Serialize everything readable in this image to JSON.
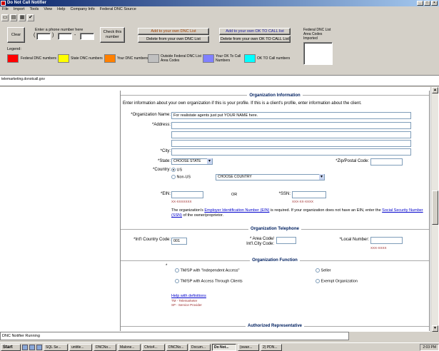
{
  "window": {
    "title": "Do Not Call Notifier",
    "min": "_",
    "max": "□",
    "close": "×"
  },
  "menu": [
    "File",
    "Import",
    "Tools",
    "View",
    "Help",
    "Company Info",
    "Federal DNC Source"
  ],
  "toolbar_icons": [
    "open-icon",
    "save-icon",
    "grid-icon",
    "check-icon"
  ],
  "controls": {
    "clear": "Clear",
    "phone_label": "Enter a phone number here",
    "paren_open": "(",
    "paren_close": ")",
    "dash": "-",
    "check": "Check this number",
    "add_dnc": "Add to your own DNC List",
    "del_dnc": "Delete from your own DNC List",
    "add_ok": "Add to your own OK TO CALL list",
    "del_ok": "Delete from your own OK TO CALL List",
    "fed_imported": "Federal DNC List Area Codes Imported"
  },
  "legend": {
    "title": "Legend:",
    "items": [
      {
        "label": "Federal DNC numbers",
        "color": "#ff0000"
      },
      {
        "label": "State DNC numbers",
        "color": "#ffff00"
      },
      {
        "label": "Your DNC numbers",
        "color": "#ff8000"
      },
      {
        "label": "Outside Federal DNC List Area Codes",
        "color": "#c0c0c0"
      },
      {
        "label": "Your OK To Call Numbers",
        "color": "#8080ff"
      },
      {
        "label": "OK TO Call numbers",
        "color": "#00ffff"
      }
    ]
  },
  "browser": {
    "address": "telemarketing.donotcall.gov"
  },
  "form": {
    "org_info_title": "Organization Information",
    "org_info_desc": "Enter information about your own organization if this is your profile. If this is a client's profile, enter information about the client.",
    "org_name_label": "*Organization Name:",
    "org_name_value": "For realistate agents just put YOUR NAME here.",
    "address_label": "*Address:",
    "city_label": "*City:",
    "state_label": "*State:",
    "state_value": "CHOOSE STATE",
    "zip_label": "*Zip/Postal Code:",
    "country_label": "*Country:",
    "country_us": "US",
    "country_nonus": "Non-US",
    "country_select": "CHOOSE COUNTRY",
    "ein_label": "*EIN:",
    "ein_hint": "XX-XXXXXXX",
    "or": "OR",
    "ssn_label": "*SSN:",
    "ssn_hint": "XXX-XX-XXXX",
    "ein_note_1": "The organization's ",
    "ein_link": "Employer Identification Number (EIN)",
    "ein_note_2": " is required. If your organization does not have an EIN, enter the ",
    "ssn_link": "Social Security Number (SSN)",
    "ein_note_3": " of the owner/proprietor.",
    "tel_title": "Organization Telephone",
    "intl_label": "*Int'l Country Code:",
    "intl_value": "001",
    "area_label": "* Area Code/ Int'l.City Code:",
    "local_label": "*Local Number:",
    "local_hint": "XXX-XXXX",
    "func_title": "Organization Function",
    "func_star": "*",
    "func_opts": [
      "TM/SP with \"Independent Access\"",
      "Seller",
      "TM/SP with Access Through Clients",
      "Exempt Organization"
    ],
    "help_link": "Help with definitions",
    "tm_def": "TM - Telemarketer",
    "sp_def": "SP - Service Provider",
    "auth_title": "Authorized Representative"
  },
  "status": "DNC Notifier Running",
  "taskbar": {
    "start": "Start",
    "tasks": [
      "SQL Se...",
      "untitle...",
      "DNCNo...",
      "Malone...",
      "Chris4...",
      "DNCNo...",
      "Docum...",
      "Do Not...",
      "(swan...",
      "2) PDN..."
    ],
    "active_index": 7,
    "clock": "2:03 PM"
  }
}
